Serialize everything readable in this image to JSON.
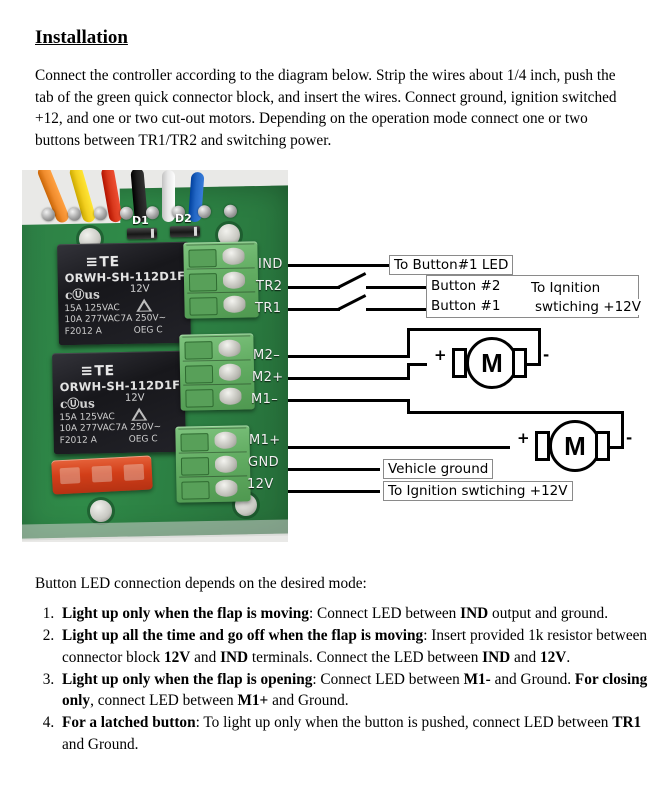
{
  "heading": "Installation",
  "intro": "Connect the controller according to the diagram below. Strip the wires about 1/4 inch, push the tab of the green quick connector block, and insert the wires. Connect ground, ignition switched +12, and one or two cut-out motors. Depending on the operation mode connect one or two buttons between TR1/TR2 and switching power.",
  "figure": {
    "board": {
      "diode_labels": [
        "D1",
        "D2"
      ],
      "relays": [
        {
          "brand": "TE",
          "part_number": "ORWH-SH-112D1F",
          "ul_mark": "cⓊus",
          "coil": "12V",
          "rating_1": "15A 125VAC",
          "rating_2": "10A 277VAC",
          "rating_3": "F2012  A",
          "rating_4": "7A  250V~",
          "rating_5": "OEG   C"
        },
        {
          "brand": "TE",
          "part_number": "ORWH-SH-112D1F",
          "ul_mark": "cⓊus",
          "coil": "12V",
          "rating_1": "15A 125VAC",
          "rating_2": "10A 277VAC",
          "rating_3": "F2012  A",
          "rating_4": "7A  250V~",
          "rating_5": "OEG   C"
        }
      ],
      "wire_colors": [
        "#ef8b2c",
        "#f2cf1f",
        "#d8381c",
        "#1d1d1d",
        "#e8e8e8",
        "#2266c4"
      ],
      "terminal_labels": [
        "IND",
        "TR2",
        "TR1",
        "M2–",
        "M2+",
        "M1–",
        "M1+",
        "GND",
        "12V"
      ]
    },
    "callouts": {
      "ind": "To Button#1 LED",
      "button2": "Button #2",
      "button1": "Button #1",
      "ignition_switch": "To Iqnition\nswtiching +12V",
      "ignition_switch_line1": "To Iqnition",
      "ignition_switch_line2": "swtiching +12V",
      "vehicle_ground": "Vehicle ground",
      "ignition_12v": "To Ignition swtiching +12V"
    },
    "motors": [
      {
        "label": "M",
        "plus": "+",
        "minus": "-"
      },
      {
        "label": "M",
        "plus": "+",
        "minus": "-"
      }
    ]
  },
  "leadin": "Button LED connection depends on the desired mode:",
  "modes": [
    {
      "bold_1": "Light up only when the flap is moving",
      "text_1": ": Connect LED between ",
      "bold_2": "IND",
      "text_2": " output and ground."
    },
    {
      "bold_1": "Light up all the time and go off when the flap is moving",
      "text_1": ": Insert provided 1k resistor between connector block ",
      "bold_2": "12V",
      "text_2": " and ",
      "bold_3": "IND",
      "text_3": " terminals. Connect the LED between ",
      "bold_4": "IND",
      "text_4": " and ",
      "bold_5": "12V",
      "text_5": "."
    },
    {
      "bold_1": "Light up only when the flap is opening",
      "text_1": ": Connect LED between ",
      "bold_2": "M1-",
      "text_2": " and Ground. ",
      "bold_3": "For closing only",
      "text_3": ", connect LED between ",
      "bold_4": "M1+",
      "text_4": " and Ground."
    },
    {
      "bold_1": "For a latched button",
      "text_1": ": To light up only when the button is pushed, connect LED between ",
      "bold_2": "TR1",
      "text_2": " and Ground."
    }
  ]
}
